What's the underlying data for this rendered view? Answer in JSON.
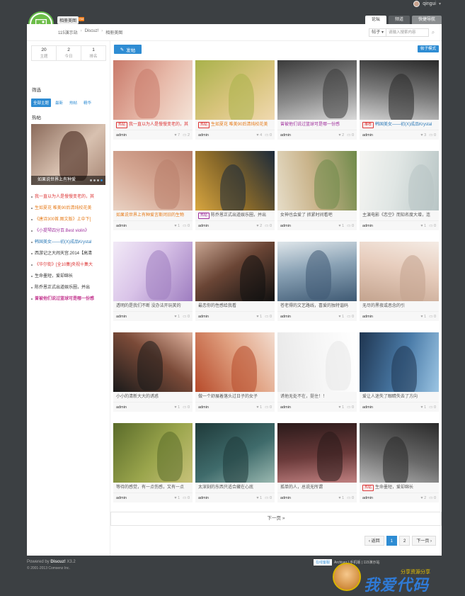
{
  "user": {
    "name": "qingui"
  },
  "header": {
    "forum_name": "相册美图",
    "hot_badge": "Hot",
    "tabs": [
      "论坛",
      "频道",
      "快捷导航"
    ]
  },
  "breadcrumb": [
    "115演示站",
    "Discuz!",
    "相册美图"
  ],
  "search": {
    "type": "帖子",
    "placeholder": "请输入搜索内容"
  },
  "stats": [
    {
      "num": "20",
      "label": "主题"
    },
    {
      "num": "2",
      "label": "今日"
    },
    {
      "num": "1",
      "label": "排名"
    }
  ],
  "sidebar": {
    "filter_heading": "筛选",
    "filters": [
      "全部主题",
      "最新",
      "热帖",
      "精华"
    ],
    "hot_heading": "热帖",
    "banner_caption": "如果说世界上有种爱",
    "hot_items": [
      {
        "text": "我一直以为人是慢慢变老的，其",
        "color": "red"
      },
      {
        "text": "生如夏花 唯美90后清纯校花美",
        "color": "orange"
      },
      {
        "text": "《唐诗300首.图文版》上中下[",
        "color": "orange"
      },
      {
        "text": "《小提琴四分百.Best violin》",
        "color": "purple"
      },
      {
        "text": "韩国美女——初(X)成品Krystal",
        "color": "blue"
      },
      {
        "text": "西游记之大闹天宫.2014【高清",
        "color": "dark"
      },
      {
        "text": "《华尔街》[全10集]央视十集大",
        "color": "red"
      },
      {
        "text": "生命墨短，爱却绵长",
        "color": "dark"
      },
      {
        "text": "陈乔恩正式出道娱乐圈，并出",
        "color": "dark"
      },
      {
        "text": "曾被他们说过篮球可是哪一份感",
        "color": "pink"
      }
    ]
  },
  "toolbar": {
    "post_label": "发帖",
    "mode_label": "帖子模式"
  },
  "cards": [
    {
      "title": "我一直以为人是慢慢变老的，其",
      "tag": "热帖",
      "tag_color": "red",
      "title_color": "red",
      "author": "admin",
      "likes": "7",
      "replies": "2",
      "bg": [
        "#c97a6a",
        "#e7b9a9",
        "#f4e3d7"
      ]
    },
    {
      "title": "生如夏花 唯美90后清纯校花美",
      "tag": "热帖",
      "tag_color": "red",
      "title_color": "orange",
      "author": "admin",
      "likes": "4",
      "replies": "0",
      "bg": [
        "#a9b24b",
        "#d8c47c",
        "#f0d9b0"
      ]
    },
    {
      "title": "曾被他们说过篮球可是哪一份感",
      "tag": "",
      "tag_color": "",
      "title_color": "purple",
      "author": "admin",
      "likes": "2",
      "replies": "0",
      "bg": [
        "#3b3b3b",
        "#8a8a8a",
        "#d9d9d9"
      ]
    },
    {
      "title": "韩国美女——初(X)成品Krystal",
      "tag": "推荐",
      "tag_color": "red",
      "title_color": "blue",
      "author": "admin",
      "likes": "3",
      "replies": "0",
      "bg": [
        "#2a2a2a",
        "#7c7c7c",
        "#cfcfcf"
      ]
    },
    {
      "title": "如果说世界上有种爱言斯闭旧的生物",
      "tag": "",
      "tag_color": "",
      "title_color": "orange",
      "author": "admin",
      "likes": "1",
      "replies": "0",
      "bg": [
        "#b97f6b",
        "#d5a793",
        "#e9d2c3"
      ]
    },
    {
      "title": "陈乔恩正式出道娱乐圈，并出",
      "tag": "热帖",
      "tag_color": "purple",
      "title_color": "dark",
      "author": "admin",
      "likes": "2",
      "replies": "0",
      "bg": [
        "#1c2a3a",
        "#8a6a2a",
        "#d8a640"
      ]
    },
    {
      "title": "女神也会爱了 抓紧时间看吧",
      "tag": "",
      "tag_color": "",
      "title_color": "dark",
      "author": "admin",
      "likes": "1",
      "replies": "0",
      "bg": [
        "#6f8a4a",
        "#c9b38a",
        "#e6ddc8"
      ]
    },
    {
      "title": "主演电影《恋空》而知名度大增，连",
      "tag": "",
      "tag_color": "",
      "title_color": "dark",
      "author": "admin",
      "likes": "1",
      "replies": "0",
      "bg": [
        "#b8c5c5",
        "#e0e6e4",
        "#f5f5f2"
      ]
    },
    {
      "title": "透明的是我们不断 没办法开玩笑的",
      "tag": "",
      "tag_color": "",
      "title_color": "dark",
      "author": "admin",
      "likes": "1",
      "replies": "0",
      "bg": [
        "#9e7dc0",
        "#d9c3e8",
        "#f2eaf7"
      ]
    },
    {
      "title": "最恋你的性感给我看",
      "tag": "",
      "tag_color": "",
      "title_color": "dark",
      "author": "admin",
      "likes": "1",
      "replies": "0",
      "bg": [
        "#101010",
        "#6a4535",
        "#c8a592"
      ]
    },
    {
      "title": "苍老得的文艺路线，喜爱的独特谐码",
      "tag": "",
      "tag_color": "",
      "title_color": "dark",
      "author": "admin",
      "likes": "1",
      "replies": "0",
      "bg": [
        "#3f5a74",
        "#8aa2b5",
        "#dfe6ea"
      ]
    },
    {
      "title": "无尽的黑夜或恶念的引",
      "tag": "",
      "tag_color": "",
      "title_color": "dark",
      "author": "admin",
      "likes": "1",
      "replies": "0",
      "bg": [
        "#c3a38e",
        "#e7cdbd",
        "#f5ece5"
      ]
    },
    {
      "title": "小小的清新大大的诱惑",
      "tag": "",
      "tag_color": "",
      "title_color": "dark",
      "author": "admin",
      "likes": "1",
      "replies": "0",
      "bg": [
        "#1a1a1a",
        "#7a4a38",
        "#e0b4a0"
      ]
    },
    {
      "title": "做一个舒展着落头过日子的女子",
      "tag": "",
      "tag_color": "",
      "title_color": "dark",
      "author": "admin",
      "likes": "1",
      "replies": "0",
      "bg": [
        "#b64a2a",
        "#e0a080",
        "#f3ddd0"
      ]
    },
    {
      "title": "诱他无处不在，挺住！！",
      "tag": "",
      "tag_color": "",
      "title_color": "dark",
      "author": "admin",
      "likes": "1",
      "replies": "0",
      "bg": [
        "#e8e8e8",
        "#f6f6f6",
        "#ffffff"
      ]
    },
    {
      "title": "爱让人迷失了眼睛失去了方向",
      "tag": "",
      "tag_color": "",
      "title_color": "dark",
      "author": "admin",
      "likes": "1",
      "replies": "0",
      "bg": [
        "#1f3550",
        "#4a7ba8",
        "#9cc5e3"
      ]
    },
    {
      "title": "等待的感觉，有一点伤感，又有一点",
      "tag": "",
      "tag_color": "",
      "title_color": "dark",
      "author": "admin",
      "likes": "1",
      "replies": "0",
      "bg": [
        "#5a6b2a",
        "#9aa54c",
        "#c8c27a"
      ]
    },
    {
      "title": "太深刻的东西只适合藏在心底",
      "tag": "",
      "tag_color": "",
      "title_color": "dark",
      "author": "admin",
      "likes": "1",
      "replies": "0",
      "bg": [
        "#1f3a3a",
        "#3f6b6b",
        "#9ab8b0"
      ]
    },
    {
      "title": "孤单的人，总说无所谓",
      "tag": "",
      "tag_color": "",
      "title_color": "dark",
      "author": "admin",
      "likes": "1",
      "replies": "0",
      "bg": [
        "#2a1a1a",
        "#6a3a3a",
        "#c08080"
      ]
    },
    {
      "title": "生命墨短，爱却绵长",
      "tag": "热帖",
      "tag_color": "red",
      "title_color": "dark",
      "author": "admin",
      "likes": "2",
      "replies": "0",
      "bg": [
        "#2a2a2a",
        "#6a6a6a",
        "#b8b8b8"
      ]
    }
  ],
  "next_page": "下一页 »",
  "pager": [
    "‹ 返回",
    "1",
    "2",
    "下一页 ›"
  ],
  "footer": {
    "powered": "Powered by",
    "brand": "Discuz!",
    "version": "X3.2",
    "copyright": "© 2001-2013 Comsenz Inc.",
    "badge": "在线客服",
    "right_text": "Archiver | 手机版 | 115演示站"
  },
  "watermark": {
    "text": "我爱代码",
    "sub": "分享资源分享"
  }
}
